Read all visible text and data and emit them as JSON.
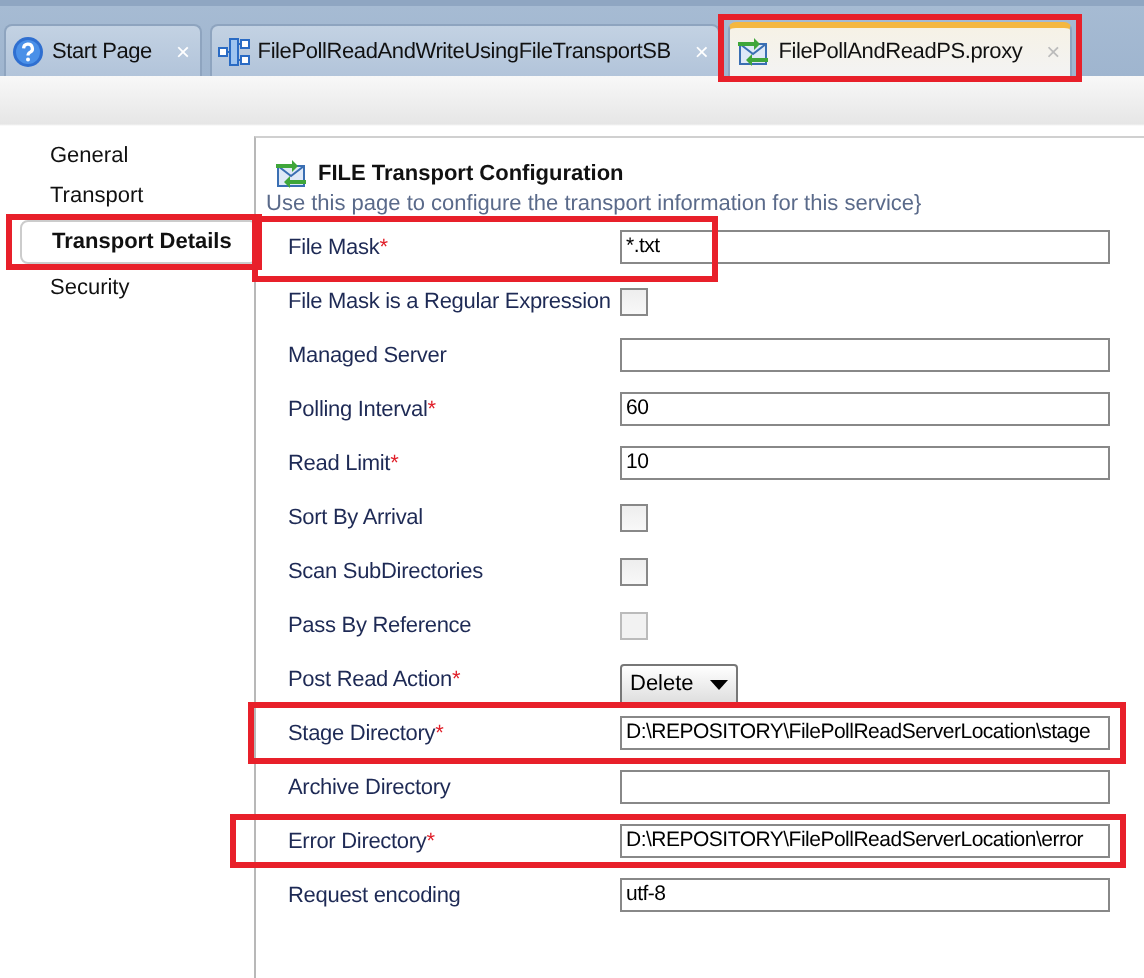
{
  "tabs": [
    {
      "label": "Start Page",
      "close": "×",
      "selected": false,
      "highlighted": false
    },
    {
      "label": "FilePollReadAndWriteUsingFileTransportSB",
      "close": "×",
      "selected": false,
      "highlighted": false
    },
    {
      "label": "FilePollAndReadPS.proxy",
      "close": "×",
      "selected": true,
      "highlighted": true
    }
  ],
  "sidebar": {
    "items": [
      {
        "label": "General",
        "selected": false,
        "highlighted": false
      },
      {
        "label": "Transport",
        "selected": false,
        "highlighted": false
      },
      {
        "label": "Transport Details",
        "selected": true,
        "highlighted": true
      },
      {
        "label": "Security",
        "selected": false,
        "highlighted": false
      }
    ]
  },
  "panel": {
    "title": "FILE Transport Configuration",
    "description": "Use this page to configure the transport information for this service}",
    "fields": [
      {
        "label": "File Mask",
        "mark": "*",
        "kind": "text",
        "value": "*.txt",
        "highlighted": true
      },
      {
        "label": "File Mask is a Regular Expression",
        "kind": "checkbox",
        "checked": false,
        "disabled": false
      },
      {
        "label": "Managed Server",
        "kind": "text"
      },
      {
        "label": "Polling Interval",
        "mark": "*",
        "kind": "text",
        "value": "60"
      },
      {
        "label": "Read Limit",
        "mark": "*",
        "kind": "text",
        "value": "10"
      },
      {
        "label": "Sort By Arrival",
        "kind": "checkbox",
        "checked": false,
        "disabled": false
      },
      {
        "label": "Scan SubDirectories",
        "kind": "checkbox",
        "checked": false,
        "disabled": false
      },
      {
        "label": "Pass By Reference",
        "kind": "checkbox",
        "checked": false,
        "disabled": true
      },
      {
        "label": "Post Read Action",
        "mark": "*",
        "kind": "select",
        "value": "Delete"
      },
      {
        "label": "Stage Directory",
        "mark": "*",
        "kind": "text",
        "value": "D:\\REPOSITORY\\FilePollReadServerLocation\\stage",
        "highlighted": true
      },
      {
        "label": "Archive Directory",
        "kind": "text"
      },
      {
        "label": "Error Directory",
        "mark": "*",
        "kind": "text",
        "value": "D:\\REPOSITORY\\FilePollReadServerLocation\\error",
        "highlighted": true
      },
      {
        "label": "Request encoding",
        "kind": "text",
        "value": "utf-8"
      }
    ]
  }
}
